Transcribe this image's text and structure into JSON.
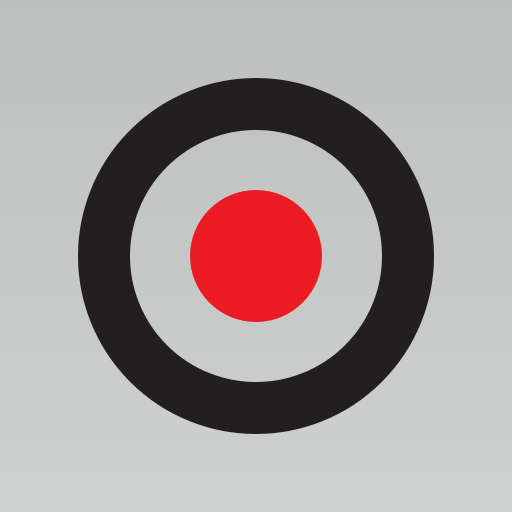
{
  "icon": {
    "name": "record-icon",
    "colors": {
      "background_top": "#bdbfbe",
      "background_bottom": "#cfd1d0",
      "ring": "#231f20",
      "dot": "#ed1c24"
    }
  }
}
